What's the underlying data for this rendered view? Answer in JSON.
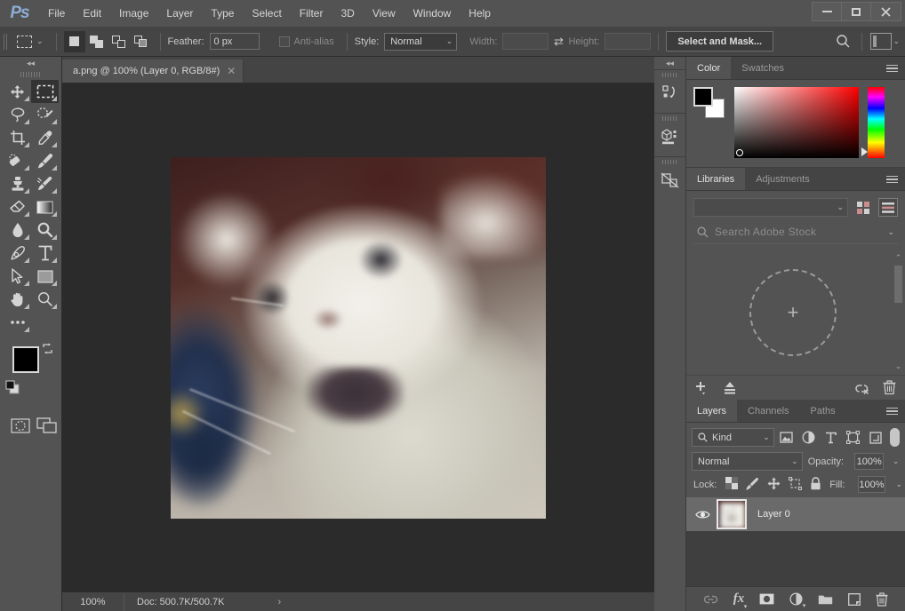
{
  "app": {
    "name": "Ps",
    "logo_color": "#8dadd6"
  },
  "menubar": {
    "items": [
      "File",
      "Edit",
      "Image",
      "Layer",
      "Type",
      "Select",
      "Filter",
      "3D",
      "View",
      "Window",
      "Help"
    ]
  },
  "window_controls": {
    "minimize": "–",
    "maximize": "□",
    "close": "✕"
  },
  "options_bar": {
    "tool_preset_name": "rectangular-marquee",
    "selection_modes": [
      "new-selection",
      "add-to-selection",
      "subtract-from-selection",
      "intersect-with-selection"
    ],
    "active_selection_mode": "new-selection",
    "feather_label": "Feather:",
    "feather_value": "0 px",
    "antialias_label": "Anti-alias",
    "antialias_checked": false,
    "style_label": "Style:",
    "style_value": "Normal",
    "width_label": "Width:",
    "width_value": "",
    "height_label": "Height:",
    "height_value": "",
    "select_and_mask_label": "Select and Mask..."
  },
  "toolbar": {
    "tools": [
      {
        "name": "move-tool",
        "active": false
      },
      {
        "name": "rectangular-marquee-tool",
        "active": true
      },
      {
        "name": "lasso-tool",
        "active": false
      },
      {
        "name": "quick-selection-tool",
        "active": false
      },
      {
        "name": "crop-tool",
        "active": false
      },
      {
        "name": "eyedropper-tool",
        "active": false
      },
      {
        "name": "spot-healing-brush-tool",
        "active": false
      },
      {
        "name": "brush-tool",
        "active": false
      },
      {
        "name": "clone-stamp-tool",
        "active": false
      },
      {
        "name": "history-brush-tool",
        "active": false
      },
      {
        "name": "eraser-tool",
        "active": false
      },
      {
        "name": "gradient-tool",
        "active": false
      },
      {
        "name": "blur-tool",
        "active": false
      },
      {
        "name": "dodge-tool",
        "active": false
      },
      {
        "name": "pen-tool",
        "active": false
      },
      {
        "name": "type-tool",
        "active": false
      },
      {
        "name": "path-selection-tool",
        "active": false
      },
      {
        "name": "rectangle-tool",
        "active": false
      },
      {
        "name": "hand-tool",
        "active": false
      },
      {
        "name": "zoom-tool",
        "active": false
      },
      {
        "name": "edit-toolbar-tool",
        "active": false
      }
    ],
    "foreground_color": "#000000",
    "background_color": "#ffffff"
  },
  "document": {
    "tab_title": "a.png @ 100% (Layer 0, RGB/8#)",
    "close_label": "✕"
  },
  "status_bar": {
    "zoom": "100%",
    "doc_info": "Doc: 500.7K/500.7K",
    "arrow": "›"
  },
  "color_panel": {
    "tabs": [
      {
        "label": "Color",
        "active": true
      },
      {
        "label": "Swatches",
        "active": false
      }
    ],
    "foreground": "#000000",
    "background": "#ffffff"
  },
  "libraries_panel": {
    "tabs": [
      {
        "label": "Libraries",
        "active": true
      },
      {
        "label": "Adjustments",
        "active": false
      }
    ],
    "library_select_value": "",
    "search_placeholder": "Search Adobe Stock",
    "drop_zone_glyph": "+",
    "footer_icons": [
      "add-icon",
      "upload-icon",
      "link-off-icon",
      "delete-icon"
    ]
  },
  "layers_panel": {
    "tabs": [
      {
        "label": "Layers",
        "active": true
      },
      {
        "label": "Channels",
        "active": false
      },
      {
        "label": "Paths",
        "active": false
      }
    ],
    "filter_kind_label": "Kind",
    "filter_icons": [
      "filter-image-icon",
      "filter-adjustment-icon",
      "filter-type-icon",
      "filter-shape-icon",
      "filter-smart-object-icon"
    ],
    "blend_mode": "Normal",
    "opacity_label": "Opacity:",
    "opacity_value": "100%",
    "lock_label": "Lock:",
    "lock_icons": [
      "lock-transparent-pixels-icon",
      "lock-image-pixels-icon",
      "lock-position-icon",
      "lock-artboard-icon",
      "lock-all-icon"
    ],
    "fill_label": "Fill:",
    "fill_value": "100%",
    "layers": [
      {
        "name": "Layer 0",
        "visible": true,
        "selected": true
      }
    ],
    "footer_icons": [
      "link-layers-icon",
      "layer-style-icon",
      "layer-mask-icon",
      "adjustment-layer-icon",
      "new-group-icon",
      "new-layer-icon",
      "delete-layer-icon"
    ],
    "layer_style_label": "fx"
  },
  "mini_dock": {
    "icons": [
      "history-icon",
      "3d-icon",
      "properties-icon"
    ]
  },
  "canvas": {
    "image_alt": "blurry white cat photo",
    "zoom_level": "100%",
    "colors": {
      "backdrop": "#2b2b2b",
      "photo_top_left": "#3d1f1e",
      "photo_blue": "#22304d",
      "photo_fur": "#e8e5dc"
    }
  }
}
